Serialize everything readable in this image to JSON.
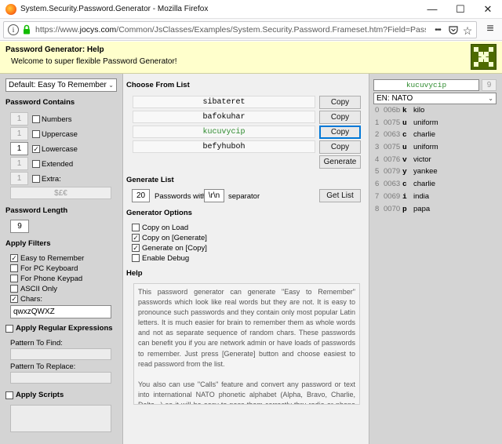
{
  "window": {
    "title": "System.Security.Password.Generator - Mozilla Firefox",
    "minimize": "—",
    "maximize": "☐",
    "close": "✕"
  },
  "urlbar": {
    "url_prefix": "https://www.",
    "url_domain": "jocys.com",
    "url_rest": "/Common/JsClasses/Examples/System.Security.Password.Frameset.htm?Field=Passwor",
    "more": "•••"
  },
  "header": {
    "title": "Password Generator: Help",
    "subtitle": "Welcome to super flexible Password Generator!"
  },
  "left": {
    "preset": "Default: Easy To Remember",
    "contains_title": "Password Contains",
    "contains": [
      {
        "count": "1",
        "label": "Numbers",
        "checked": ""
      },
      {
        "count": "1",
        "label": "Uppercase",
        "checked": ""
      },
      {
        "count": "1",
        "label": "Lowercase",
        "checked": "✓"
      },
      {
        "count": "1",
        "label": "Extended",
        "checked": ""
      },
      {
        "count": "1",
        "label": "Extra:",
        "checked": ""
      }
    ],
    "extra_value": "$£€",
    "length_title": "Password Length",
    "length_value": "9",
    "filters_title": "Apply Filters",
    "filters": [
      {
        "label": "Easy to Remember",
        "checked": "✓"
      },
      {
        "label": "For PC Keyboard",
        "checked": ""
      },
      {
        "label": "For Phone Keypad",
        "checked": ""
      },
      {
        "label": "ASCII Only",
        "checked": ""
      },
      {
        "label": "Chars:",
        "checked": "✓"
      }
    ],
    "chars_value": "qwxzQWXZ",
    "regex_title": "Apply Regular Expressions",
    "pattern_find": "Pattern To Find:",
    "pattern_replace": "Pattern To Replace:",
    "scripts_title": "Apply Scripts"
  },
  "middle": {
    "choose_title": "Choose From List",
    "passwords": [
      "sibateret",
      "bafokuhar",
      "kucuvycip",
      "befyhuboh"
    ],
    "copy_label": "Copy",
    "generate_label": "Generate",
    "generate_list_title": "Generate List",
    "list_count": "20",
    "passwords_with": "Passwords with",
    "separator_value": "\\r\\n",
    "separator_label": "separator",
    "get_list_label": "Get List",
    "options_title": "Generator Options",
    "options": [
      {
        "label": "Copy on Load",
        "checked": ""
      },
      {
        "label": "Copy on [Generate]",
        "checked": "✓"
      },
      {
        "label": "Generate on [Copy]",
        "checked": "✓"
      },
      {
        "label": "Enable Debug",
        "checked": ""
      }
    ],
    "help_title": "Help",
    "help_p1": "This password generator can generate \"Easy to Remember\" passwords which look like real words but they are not. It is easy to pronounce such passwords and they contain only most popular Latin letters. It is much easier for brain to remember them as whole words and not as separate sequence of random chars. These passwords can benefit you if you are network admin or have loads of passwords to remember. Just press [Generate] button and choose easiest to read password from the list.",
    "help_p2": "You also can use \"Calls\" feature and convert any password or text into international NATO phonetic alphabet (Alpha, Bravo, Charlie, Delta...) so it will be easy to pass them correctly thru radio or phone conversation."
  },
  "right": {
    "password": "kucuvycip",
    "length": "9",
    "alphabet": "EN: NATO",
    "rows": [
      {
        "idx": "0",
        "code": "006b",
        "ch": "k",
        "word": "kilo"
      },
      {
        "idx": "1",
        "code": "0075",
        "ch": "u",
        "word": "uniform"
      },
      {
        "idx": "2",
        "code": "0063",
        "ch": "c",
        "word": "charlie"
      },
      {
        "idx": "3",
        "code": "0075",
        "ch": "u",
        "word": "uniform"
      },
      {
        "idx": "4",
        "code": "0076",
        "ch": "v",
        "word": "victor"
      },
      {
        "idx": "5",
        "code": "0079",
        "ch": "y",
        "word": "yankee"
      },
      {
        "idx": "6",
        "code": "0063",
        "ch": "c",
        "word": "charlie"
      },
      {
        "idx": "7",
        "code": "0069",
        "ch": "i",
        "word": "india"
      },
      {
        "idx": "8",
        "code": "0070",
        "ch": "p",
        "word": "papa"
      }
    ]
  },
  "icons": {
    "info": "i",
    "pocket": "♥",
    "bookmark": "☆",
    "menu": "≡",
    "dropdown": "⌄"
  },
  "colors": {
    "header_bg": "#ffffcc",
    "panel_gray": "#d4d4d4",
    "selected_password": "#2e8b2e",
    "logo": "#4d6a00",
    "focus_blue": "#0078d7"
  }
}
